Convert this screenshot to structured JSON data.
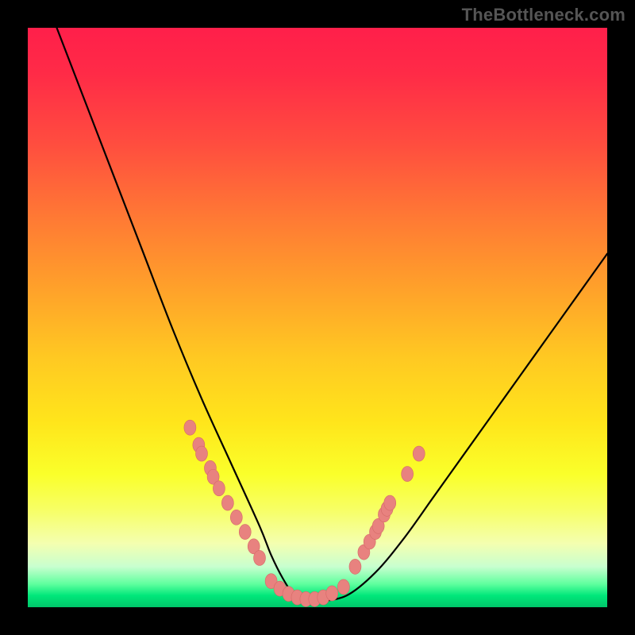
{
  "attribution": "TheBottleneck.com",
  "chart_data": {
    "type": "line",
    "title": "",
    "xlabel": "",
    "ylabel": "",
    "xlim": [
      0,
      100
    ],
    "ylim": [
      0,
      100
    ],
    "grid": false,
    "legend": false,
    "series": [
      {
        "name": "bottleneck-curve",
        "x": [
          5,
          10,
          15,
          20,
          25,
          30,
          35,
          40,
          42,
          44,
          46,
          48,
          50,
          55,
          60,
          65,
          70,
          75,
          80,
          85,
          90,
          95,
          100
        ],
        "y": [
          100,
          87,
          74,
          61,
          48,
          36,
          25,
          14,
          9,
          5,
          2,
          1,
          1,
          2,
          6,
          12,
          19,
          26,
          33,
          40,
          47,
          54,
          61
        ]
      }
    ],
    "marker_clusters": [
      {
        "name": "left-cluster",
        "x": [
          28,
          29.5,
          30,
          31.5,
          32,
          33,
          34.5,
          36,
          37.5,
          39,
          40
        ],
        "y": [
          31,
          28,
          26.5,
          24,
          22.5,
          20.5,
          18,
          15.5,
          13,
          10.5,
          8.5
        ]
      },
      {
        "name": "bottom-cluster",
        "x": [
          42,
          43.5,
          45,
          46.5,
          48,
          49.5,
          51,
          52.5,
          54.5
        ],
        "y": [
          4.5,
          3.2,
          2.3,
          1.7,
          1.4,
          1.4,
          1.7,
          2.4,
          3.5
        ]
      },
      {
        "name": "right-cluster",
        "x": [
          56.5,
          58,
          59,
          60,
          60.5,
          61.5,
          62,
          62.5,
          65.5,
          67.5
        ],
        "y": [
          7,
          9.5,
          11.3,
          13,
          14,
          16,
          17,
          18,
          23,
          26.5
        ]
      }
    ],
    "colors": {
      "curve": "#000000",
      "marker_fill": "#e8827f",
      "marker_stroke": "#d56a67"
    }
  }
}
